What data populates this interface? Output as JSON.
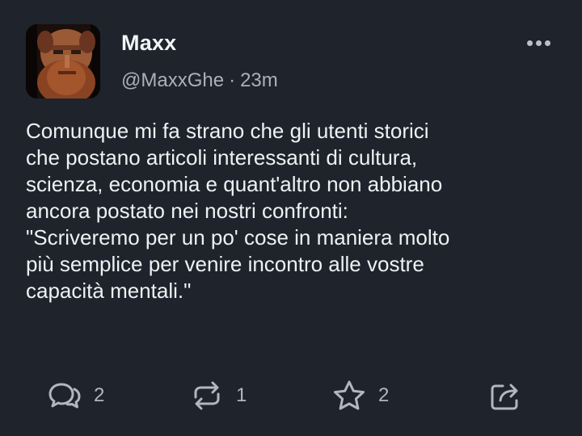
{
  "author": {
    "name": "Maxx",
    "handle": "@MaxxGhe",
    "time": "23m",
    "avatar_icon": "user-avatar-photo"
  },
  "post": {
    "lines": [
      "Comunque mi fa strano che gli utenti storici",
      "che postano articoli interessanti di cultura,",
      "scienza, economia e quant'altro non abbiano",
      "ancora postato nei nostri confronti:",
      "\"Scriveremo per un po' cose in maniera molto",
      "più semplice per venire incontro alle vostre",
      "capacità mentali.\""
    ]
  },
  "actions": {
    "reply": {
      "icon": "reply-icon",
      "count": "2"
    },
    "repost": {
      "icon": "repost-icon",
      "count": "1"
    },
    "favourite": {
      "icon": "star-icon",
      "count": "2"
    },
    "share": {
      "icon": "share-icon"
    }
  },
  "colors": {
    "background": "#1f232b",
    "text": "#eef1f4",
    "muted": "#a9b1bb",
    "icon": "#b0b7c0"
  }
}
